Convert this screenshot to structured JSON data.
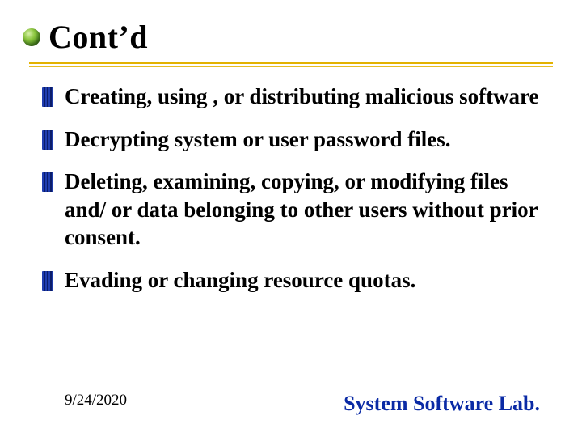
{
  "title": "Cont’d",
  "bullets": [
    "Creating, using , or distributing malicious software",
    "Decrypting system or user password files.",
    "Deleting, examining, copying, or modifying files and/ or data belonging to other users without prior consent.",
    "Evading or changing resource quotas."
  ],
  "footer": {
    "date": "9/24/2020",
    "lab": "System Software Lab."
  }
}
